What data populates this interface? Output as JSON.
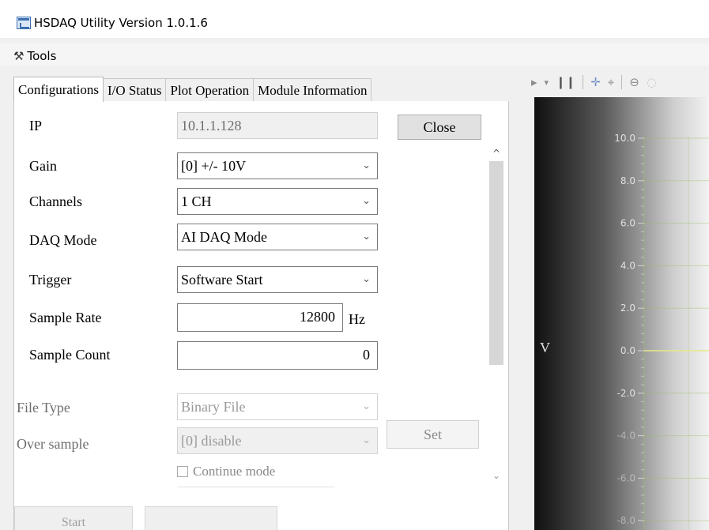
{
  "window": {
    "title": "HSDAQ Utility Version 1.0.1.6",
    "app_icon": "app-window-icon"
  },
  "menu": {
    "tools_label": "Tools",
    "tools_icon": "tools-icon"
  },
  "tabs": [
    {
      "label": "Configurations",
      "active": true
    },
    {
      "label": "I/O Status",
      "active": false
    },
    {
      "label": "Plot Operation",
      "active": false
    },
    {
      "label": "Module Information",
      "active": false
    }
  ],
  "config": {
    "ip_label": "IP",
    "ip_value": "10.1.1.128",
    "close_button": "Close",
    "gain_label": "Gain",
    "gain_value": "[0] +/- 10V",
    "channels_label": "Channels",
    "channels_value": "1 CH",
    "daq_mode_label": "DAQ Mode",
    "daq_mode_value": "AI DAQ Mode",
    "trigger_label": "Trigger",
    "trigger_value": "Software Start",
    "sample_rate_label": "Sample Rate",
    "sample_rate_value": "12800",
    "sample_rate_unit": "Hz",
    "sample_count_label": "Sample Count",
    "sample_count_value": "0",
    "file_type_label": "File Type",
    "file_type_value": "Binary File",
    "over_sample_label": "Over sample",
    "over_sample_value": "[0] disable",
    "set_button": "Set",
    "continue_mode_label": "Continue mode",
    "continue_mode_checked": false
  },
  "bottom_buttons": {
    "start_label": "Start",
    "stop_label": ""
  },
  "plot": {
    "y_axis_label": "V",
    "y_ticks": [
      "10.0",
      "8.0",
      "6.0",
      "4.0",
      "2.0",
      "0.0",
      "-2.0",
      "-4.0",
      "-6.0",
      "-8.0"
    ],
    "toolbar_icons": [
      "play-icon",
      "dropdown-icon",
      "pause-icon",
      "pan-icon",
      "zoom-icon",
      "zoom-out-icon"
    ],
    "colors": {
      "grid": "#9fbf6f",
      "trace": "#e8e88a",
      "axis": "#d0d0d0"
    }
  }
}
